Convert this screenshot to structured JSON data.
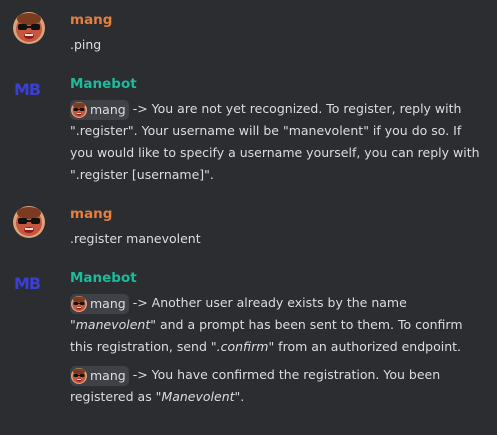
{
  "messages": [
    {
      "author": "mang",
      "author_color": "#e67e3d",
      "avatar_icon": "sunglasses-face-avatar-icon",
      "text": ".ping"
    },
    {
      "author": "Manebot",
      "author_color": "#1abc9c",
      "avatar_text": "MB",
      "avatar_color": "#3b3fd6",
      "mention": "mang",
      "text_1": "-> You are not yet recognized. To register, reply with \".register\". Your username will be \"manevolent\" if you do so. If you would like to specify a username yourself, you can reply with \".register [username]\"."
    },
    {
      "author": "mang",
      "author_color": "#e67e3d",
      "avatar_icon": "sunglasses-face-avatar-icon",
      "text": ".register manevolent"
    },
    {
      "author": "Manebot",
      "author_color": "#1abc9c",
      "avatar_text": "MB",
      "avatar_color": "#3b3fd6",
      "line1": {
        "mention": "mang",
        "pre": "-> Another user already exists by the name \"",
        "italic1": "manevolent",
        "mid": "\" and a prompt has been sent to them. To confirm this registration, send \"",
        "italic2": ".confirm",
        "post": "\" from an authorized endpoint."
      },
      "line2": {
        "mention": "mang",
        "pre": "-> You have confirmed the registration. You been registered as \"",
        "italic": "Manevolent",
        "post": "\"."
      }
    }
  ]
}
